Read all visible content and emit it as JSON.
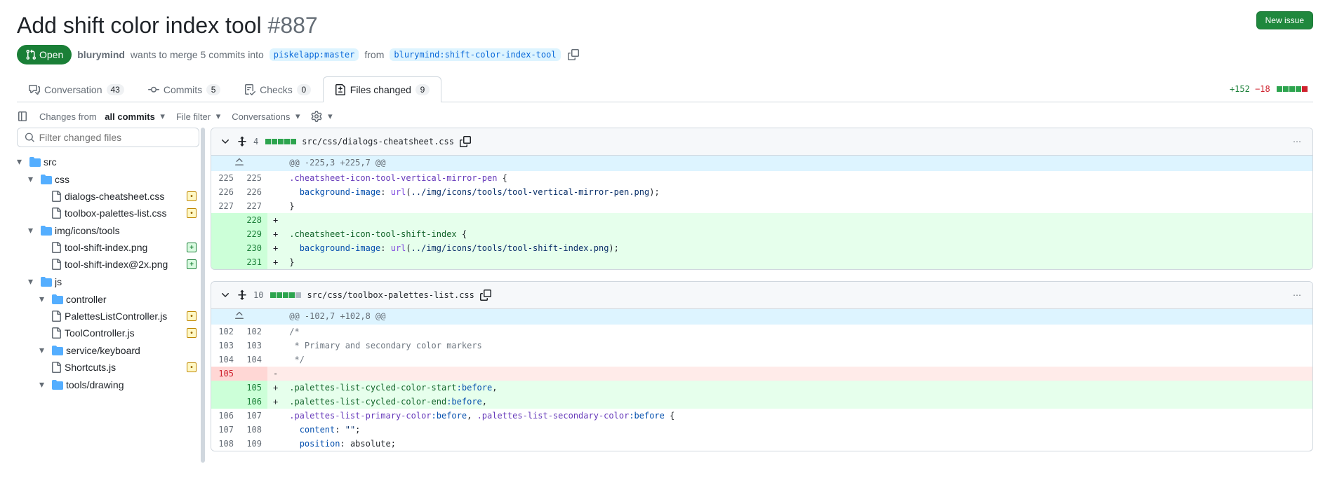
{
  "header": {
    "title": "Add shift color index tool",
    "issue_number": "#887",
    "new_issue_btn": "New issue"
  },
  "meta": {
    "state": "Open",
    "author": "blurymind",
    "wants_to_merge": "wants to merge 5 commits into",
    "base_branch": "piskelapp:master",
    "from_word": "from",
    "head_branch": "blurymind:shift-color-index-tool"
  },
  "tabs": {
    "conversation": {
      "label": "Conversation",
      "count": "43"
    },
    "commits": {
      "label": "Commits",
      "count": "5"
    },
    "checks": {
      "label": "Checks",
      "count": "0"
    },
    "files": {
      "label": "Files changed",
      "count": "9"
    }
  },
  "diffstat": {
    "additions": "+152",
    "deletions": "−18"
  },
  "toolbar": {
    "changes_prefix": "Changes from",
    "changes_value": "all commits",
    "file_filter": "File filter",
    "conversations": "Conversations"
  },
  "filter_placeholder": "Filter changed files",
  "tree": {
    "src": "src",
    "css": "css",
    "dialogs_cheatsheet": "dialogs-cheatsheet.css",
    "toolbox_palettes": "toolbox-palettes-list.css",
    "img_icons_tools": "img/icons/tools",
    "tool_shift_png": "tool-shift-index.png",
    "tool_shift_2x": "tool-shift-index@2x.png",
    "js": "js",
    "controller": "controller",
    "palettes_ctrl": "PalettesListController.js",
    "tool_ctrl": "ToolController.js",
    "service_keyboard": "service/keyboard",
    "shortcuts": "Shortcuts.js",
    "tools_drawing": "tools/drawing"
  },
  "file1": {
    "count": "4",
    "path": "src/css/dialogs-cheatsheet.css",
    "hunk": "@@ -225,3 +225,7 @@",
    "l225a": "225",
    "l225b": "225",
    "l226a": "226",
    "l226b": "226",
    "l227a": "227",
    "l227b": "227",
    "l228b": "228",
    "l229b": "229",
    "l230b": "230",
    "l231b": "231",
    "row225_sel": ".cheatsheet-icon-tool-vertical-mirror-pen",
    "row225_brace": " {",
    "row226_prop": "background-image",
    "row226_func": "url",
    "row226_arg": "../img/icons/tools/tool-vertical-mirror-pen.png",
    "row227": "}",
    "row229_sel": ".cheatsheet-icon-tool-shift-index",
    "row229_brace": " {",
    "row230_prop": "background-image",
    "row230_func": "url",
    "row230_arg": "../img/icons/tools/tool-shift-index.png",
    "row231": "}"
  },
  "file2": {
    "count": "10",
    "path": "src/css/toolbox-palettes-list.css",
    "hunk": "@@ -102,7 +102,8 @@",
    "l102a": "102",
    "l102b": "102",
    "l103a": "103",
    "l103b": "103",
    "l104a": "104",
    "l104b": "104",
    "l105a": "105",
    "l105b": "105",
    "l106b": "106",
    "l106a": "106",
    "l107b": "107",
    "l107a": "107",
    "l108b": "108",
    "l108a": "108",
    "l109b": "109",
    "row102": "/*",
    "row103": " * Primary and secondary color markers",
    "row104": " */",
    "row105_del": "",
    "row105_add_sel": ".palettes-list-cycled-color-start",
    "row105_add_pseudo": ":before",
    "row106_add_sel": ".palettes-list-cycled-color-end",
    "row106_add_pseudo": ":before",
    "row106_sel1": ".palettes-list-primary-color",
    "row106_pseudo": ":before",
    "row106_sel2": ".palettes-list-secondary-color",
    "row106_brace": " {",
    "row107_prop": "content",
    "row107_val": "\"\"",
    "row108_prop": "position",
    "row108_val": "absolute"
  }
}
